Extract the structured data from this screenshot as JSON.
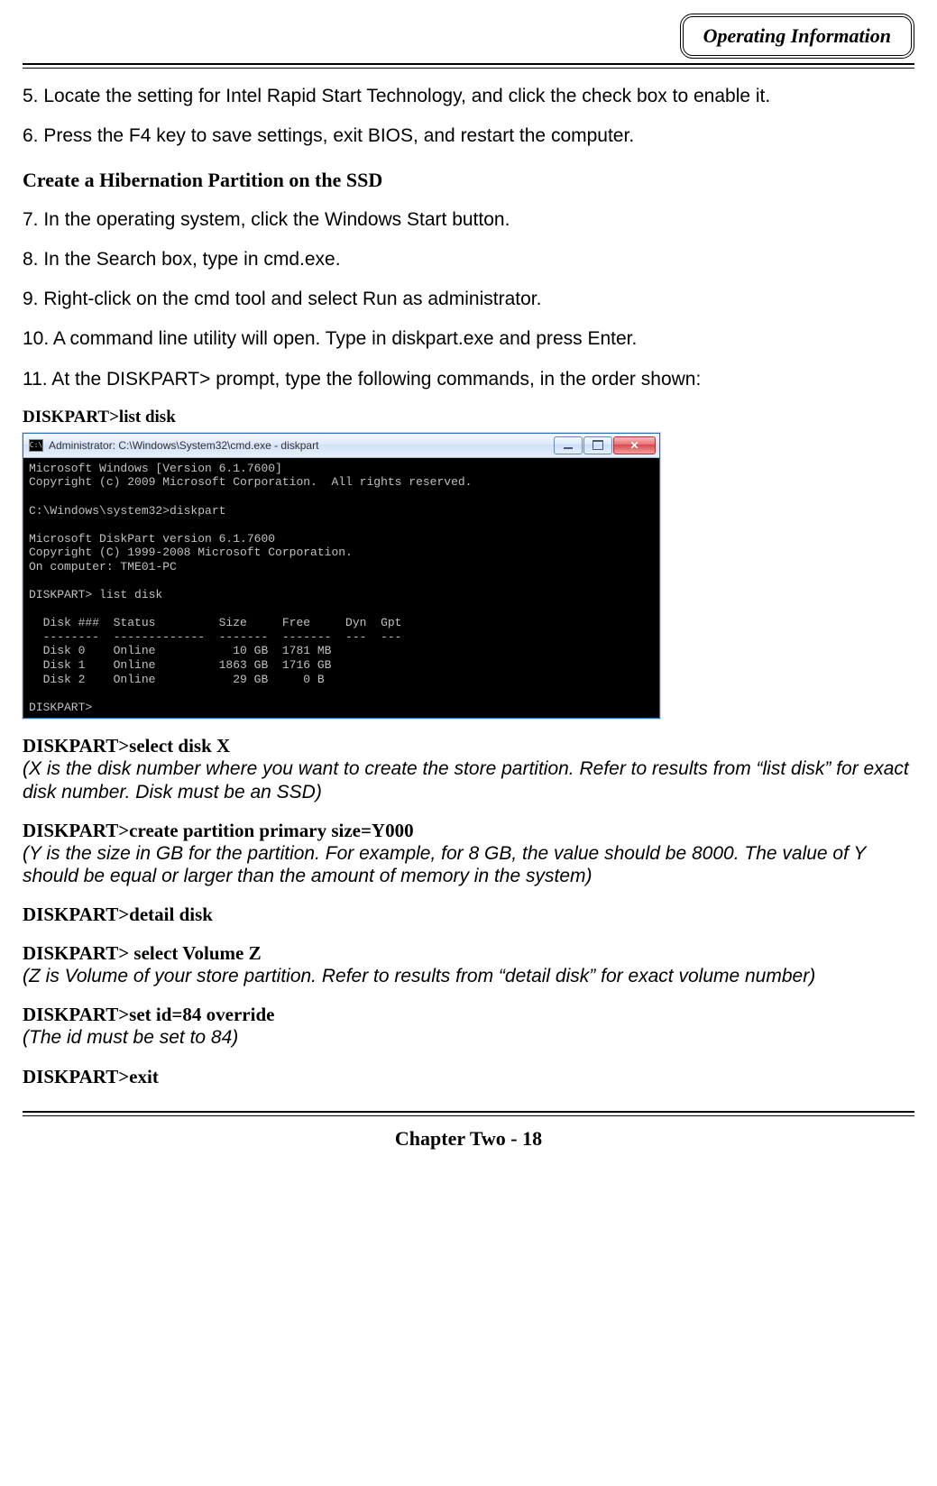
{
  "header": {
    "badge": "Operating Information"
  },
  "steps": {
    "s5": "5. Locate the setting for Intel Rapid Start Technology, and click the check box to enable it.",
    "s6": "6. Press the F4 key to save settings, exit BIOS, and restart the computer.",
    "heading": "Create a Hibernation Partition on the SSD",
    "s7": "7. In the operating system, click the Windows Start button.",
    "s8": "8. In the Search box, type in cmd.exe.",
    "s9": "9. Right-click on the cmd tool and select Run as administrator.",
    "s10": "10. A command line utility will open. Type in diskpart.exe and press Enter.",
    "s11": "11. At the DISKPART> prompt, type the following commands, in the order shown:"
  },
  "cmd_label": "DISKPART>list disk",
  "cmd_window": {
    "title_prefix": "C:\\",
    "title": "Administrator: C:\\Windows\\System32\\cmd.exe - diskpart",
    "body": "Microsoft Windows [Version 6.1.7600]\nCopyright (c) 2009 Microsoft Corporation.  All rights reserved.\n\nC:\\Windows\\system32>diskpart\n\nMicrosoft DiskPart version 6.1.7600\nCopyright (C) 1999-2008 Microsoft Corporation.\nOn computer: TME01-PC\n\nDISKPART> list disk\n\n  Disk ###  Status         Size     Free     Dyn  Gpt\n  --------  -------------  -------  -------  ---  ---\n  Disk 0    Online           10 GB  1781 MB\n  Disk 1    Online         1863 GB  1716 GB\n  Disk 2    Online           29 GB     0 B\n\nDISKPART>"
  },
  "commands": {
    "select_disk": "DISKPART>select disk X",
    "select_disk_note": "(X is the disk number where you want to create the store partition. Refer to results from “list disk” for exact disk number. Disk must be an SSD)",
    "create_part": "DISKPART>create partition primary size=Y000",
    "create_part_note": "(Y is the size in GB for the partition. For example, for 8 GB, the value should be 8000. The value of Y should be equal or larger than the amount of memory in the system)",
    "detail_disk": "DISKPART>detail disk",
    "select_vol": "DISKPART> select Volume Z",
    "select_vol_note": "(Z is Volume of your store partition. Refer to results from “detail disk” for exact volume number)",
    "set_id": "DISKPART>set id=84 override",
    "set_id_note": "(The id must be set to 84)",
    "exit": "DISKPART>exit"
  },
  "footer": "Chapter Two - 18"
}
